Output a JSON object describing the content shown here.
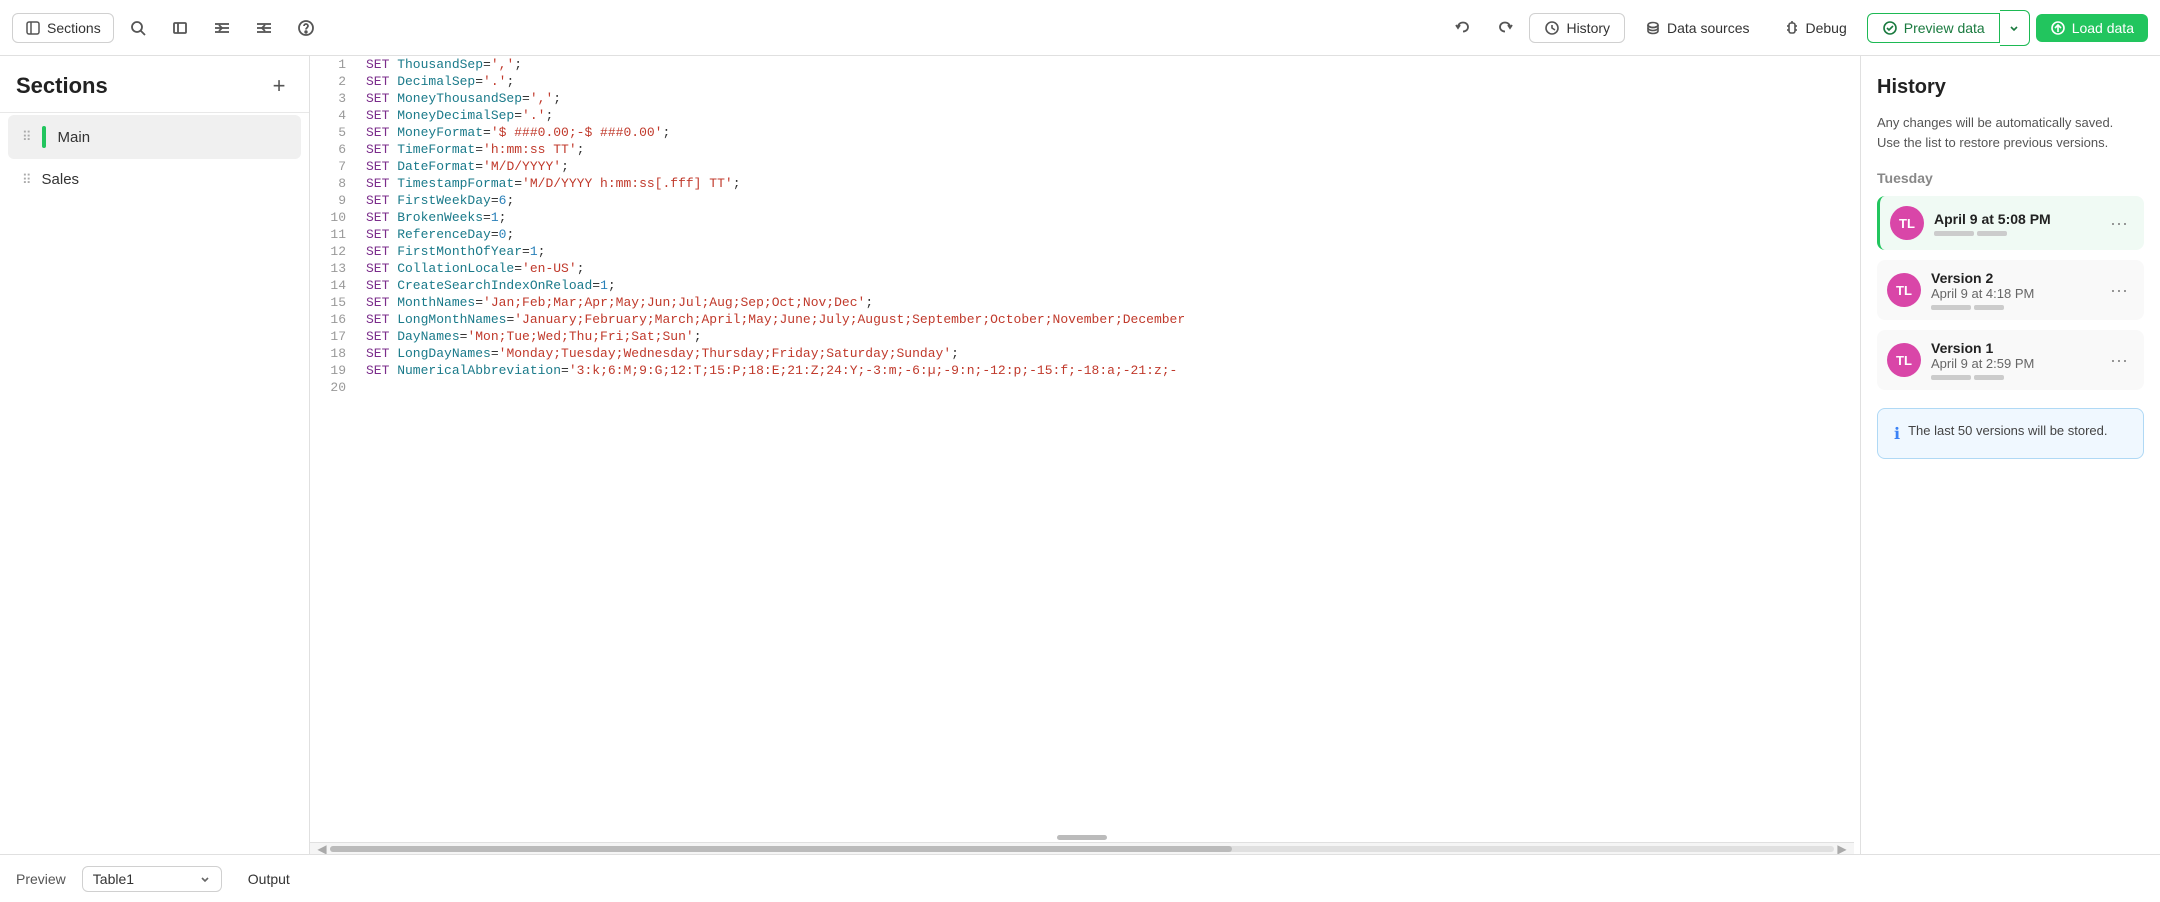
{
  "toolbar": {
    "sections_label": "Sections",
    "history_label": "History",
    "data_sources_label": "Data sources",
    "debug_label": "Debug",
    "preview_data_label": "Preview data",
    "load_data_label": "Load data"
  },
  "sidebar": {
    "title": "Sections",
    "items": [
      {
        "id": "main",
        "label": "Main",
        "active": true
      },
      {
        "id": "sales",
        "label": "Sales",
        "active": false
      }
    ]
  },
  "editor": {
    "lines": [
      {
        "num": 1,
        "code": "SET ThousandSep=',';",
        "tokens": [
          [
            "kw",
            "SET"
          ],
          [
            "fn",
            " ThousandSep"
          ],
          [
            "",
            "="
          ],
          [
            "str",
            "','"
          ],
          [
            "",
            ";"
          ]
        ]
      },
      {
        "num": 2,
        "code": "SET DecimalSep='.';",
        "tokens": [
          [
            "kw",
            "SET"
          ],
          [
            "fn",
            " DecimalSep"
          ],
          [
            "",
            "="
          ],
          [
            "str",
            "'.'"
          ],
          [
            "",
            ";"
          ]
        ]
      },
      {
        "num": 3,
        "code": "SET MoneyThousandSep=',';",
        "tokens": [
          [
            "kw",
            "SET"
          ],
          [
            "fn",
            " MoneyThousandSep"
          ],
          [
            "",
            "="
          ],
          [
            "str",
            "','"
          ],
          [
            "",
            ";"
          ]
        ]
      },
      {
        "num": 4,
        "code": "SET MoneyDecimalSep='.';",
        "tokens": [
          [
            "kw",
            "SET"
          ],
          [
            "fn",
            " MoneyDecimalSep"
          ],
          [
            "",
            "="
          ],
          [
            "str",
            "'.'"
          ],
          [
            "",
            ";"
          ]
        ]
      },
      {
        "num": 5,
        "code": "SET MoneyFormat='$ ###0.00;-$ ###0.00';",
        "tokens": [
          [
            "kw",
            "SET"
          ],
          [
            "fn",
            " MoneyFormat"
          ],
          [
            "",
            "="
          ],
          [
            "str",
            "'$ ###0.00;-$ ###0.00'"
          ],
          [
            "",
            ";"
          ]
        ]
      },
      {
        "num": 6,
        "code": "SET TimeFormat='h:mm:ss TT';",
        "tokens": [
          [
            "kw",
            "SET"
          ],
          [
            "fn",
            " TimeFormat"
          ],
          [
            "",
            "="
          ],
          [
            "str",
            "'h:mm:ss TT'"
          ],
          [
            "",
            ";"
          ]
        ]
      },
      {
        "num": 7,
        "code": "SET DateFormat='M/D/YYYY';",
        "tokens": [
          [
            "kw",
            "SET"
          ],
          [
            "fn",
            " DateFormat"
          ],
          [
            "",
            "="
          ],
          [
            "str",
            "'M/D/YYYY'"
          ],
          [
            "",
            ";"
          ]
        ]
      },
      {
        "num": 8,
        "code": "SET TimestampFormat='M/D/YYYY h:mm:ss[.fff] TT';",
        "tokens": [
          [
            "kw",
            "SET"
          ],
          [
            "fn",
            " TimestampFormat"
          ],
          [
            "",
            "="
          ],
          [
            "str",
            "'M/D/YYYY h:mm:ss[.fff] TT'"
          ],
          [
            "",
            ";"
          ]
        ]
      },
      {
        "num": 9,
        "code": "SET FirstWeekDay=6;",
        "tokens": [
          [
            "kw",
            "SET"
          ],
          [
            "fn",
            " FirstWeekDay"
          ],
          [
            "",
            "="
          ],
          [
            "num",
            "6"
          ],
          [
            "",
            ";"
          ]
        ]
      },
      {
        "num": 10,
        "code": "SET BrokenWeeks=1;",
        "tokens": [
          [
            "kw",
            "SET"
          ],
          [
            "fn",
            " BrokenWeeks"
          ],
          [
            "",
            "="
          ],
          [
            "num",
            "1"
          ],
          [
            "",
            ";"
          ]
        ]
      },
      {
        "num": 11,
        "code": "SET ReferenceDay=0;",
        "tokens": [
          [
            "kw",
            "SET"
          ],
          [
            "fn",
            " ReferenceDay"
          ],
          [
            "",
            "="
          ],
          [
            "num",
            "0"
          ],
          [
            "",
            ";"
          ]
        ]
      },
      {
        "num": 12,
        "code": "SET FirstMonthOfYear=1;",
        "tokens": [
          [
            "kw",
            "SET"
          ],
          [
            "fn",
            " FirstMonthOfYear"
          ],
          [
            "",
            "="
          ],
          [
            "num",
            "1"
          ],
          [
            "",
            ";"
          ]
        ]
      },
      {
        "num": 13,
        "code": "SET CollationLocale='en-US';",
        "tokens": [
          [
            "kw",
            "SET"
          ],
          [
            "fn",
            " CollationLocale"
          ],
          [
            "",
            "="
          ],
          [
            "str",
            "'en-US'"
          ],
          [
            "",
            ";"
          ]
        ]
      },
      {
        "num": 14,
        "code": "SET CreateSearchIndexOnReload=1;",
        "tokens": [
          [
            "kw",
            "SET"
          ],
          [
            "fn",
            " CreateSearchIndexOnReload"
          ],
          [
            "",
            "="
          ],
          [
            "num",
            "1"
          ],
          [
            "",
            ";"
          ]
        ]
      },
      {
        "num": 15,
        "code": "SET MonthNames='Jan;Feb;Mar;Apr;May;Jun;Jul;Aug;Sep;Oct;Nov;Dec';",
        "tokens": [
          [
            "kw",
            "SET"
          ],
          [
            "fn",
            " MonthNames"
          ],
          [
            "",
            "="
          ],
          [
            "str",
            "'Jan;Feb;Mar;Apr;May;Jun;Jul;Aug;Sep;Oct;Nov;Dec'"
          ],
          [
            "",
            ";"
          ]
        ]
      },
      {
        "num": 16,
        "code": "SET LongMonthNames='January;February;March;April;May;June;July;August;September;October;November;December",
        "tokens": [
          [
            "kw",
            "SET"
          ],
          [
            "fn",
            " LongMonthNames"
          ],
          [
            "",
            "="
          ],
          [
            "str",
            "'January;February;March;April;May;June;July;August;September;October;November;December"
          ]
        ]
      },
      {
        "num": 17,
        "code": "SET DayNames='Mon;Tue;Wed;Thu;Fri;Sat;Sun';",
        "tokens": [
          [
            "kw",
            "SET"
          ],
          [
            "fn",
            " DayNames"
          ],
          [
            "",
            "="
          ],
          [
            "str",
            "'Mon;Tue;Wed;Thu;Fri;Sat;Sun'"
          ],
          [
            "",
            ";"
          ]
        ]
      },
      {
        "num": 18,
        "code": "SET LongDayNames='Monday;Tuesday;Wednesday;Thursday;Friday;Saturday;Sunday';",
        "tokens": [
          [
            "kw",
            "SET"
          ],
          [
            "fn",
            " LongDayNames"
          ],
          [
            "",
            "="
          ],
          [
            "str",
            "'Monday;Tuesday;Wednesday;Thursday;Friday;Saturday;Sunday'"
          ],
          [
            "",
            ";"
          ]
        ]
      },
      {
        "num": 19,
        "code": "SET NumericalAbbreviation='3:k;6:M;9:G;12:T;15:P;18:E;21:Z;24:Y;-3:m;-6:µ;-9:n;-12:p;-15:f;-18:a;-21:z;-",
        "tokens": [
          [
            "kw",
            "SET"
          ],
          [
            "fn",
            " NumericalAbbreviation"
          ],
          [
            "",
            "="
          ],
          [
            "str",
            "'3:k;6:M;9:G;12:T;15:P;18:E;21:Z;24:Y;-3:m;-6:µ;-9:n;-12:p;-15:f;-18:a;-21:z;-"
          ]
        ]
      },
      {
        "num": 20,
        "code": ""
      }
    ]
  },
  "history": {
    "title": "History",
    "subtitle_line1": "Any changes will be automatically saved.",
    "subtitle_line2": "Use the list to restore previous versions.",
    "day_label": "Tuesday",
    "entries": [
      {
        "id": "current",
        "avatar": "TL",
        "time": "April 9 at 5:08 PM",
        "is_current": true
      },
      {
        "id": "v2",
        "avatar": "TL",
        "version_label": "Version 2",
        "time": "April 9 at 4:18 PM",
        "is_current": false
      },
      {
        "id": "v1",
        "avatar": "TL",
        "version_label": "Version 1",
        "time": "April 9 at 2:59 PM",
        "is_current": false
      }
    ],
    "notice": "The last 50 versions will be stored."
  },
  "bottom": {
    "preview_label": "Preview",
    "table_value": "Table1",
    "output_label": "Output"
  }
}
